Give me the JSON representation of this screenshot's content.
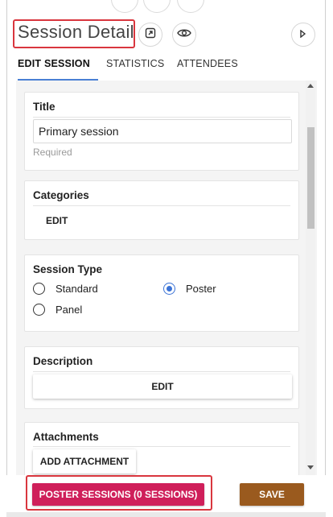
{
  "header": {
    "title": "Session Detail",
    "icons": [
      "open-external-icon",
      "eye-icon",
      "play-right-icon"
    ]
  },
  "tabs": [
    {
      "label": "EDIT SESSION",
      "active": true
    },
    {
      "label": "STATISTICS",
      "active": false
    },
    {
      "label": "ATTENDEES",
      "active": false
    }
  ],
  "form": {
    "title": {
      "label": "Title",
      "value": "Primary session",
      "hint": "Required"
    },
    "categories": {
      "label": "Categories",
      "button": "EDIT"
    },
    "session_type": {
      "label": "Session Type",
      "options": [
        {
          "label": "Standard",
          "selected": false
        },
        {
          "label": "Poster",
          "selected": true
        },
        {
          "label": "Panel",
          "selected": false
        }
      ]
    },
    "description": {
      "label": "Description",
      "button": "EDIT"
    },
    "attachments": {
      "label": "Attachments",
      "button": "ADD ATTACHMENT"
    }
  },
  "footer": {
    "poster_sessions_label": "POSTER SESSIONS (0 SESSIONS)",
    "save_label": "SAVE"
  },
  "colors": {
    "accent_blue": "#3b73d6",
    "poster_button": "#cf1f5a",
    "save_button": "#9a5a1e",
    "highlight_red": "#d9363e"
  }
}
